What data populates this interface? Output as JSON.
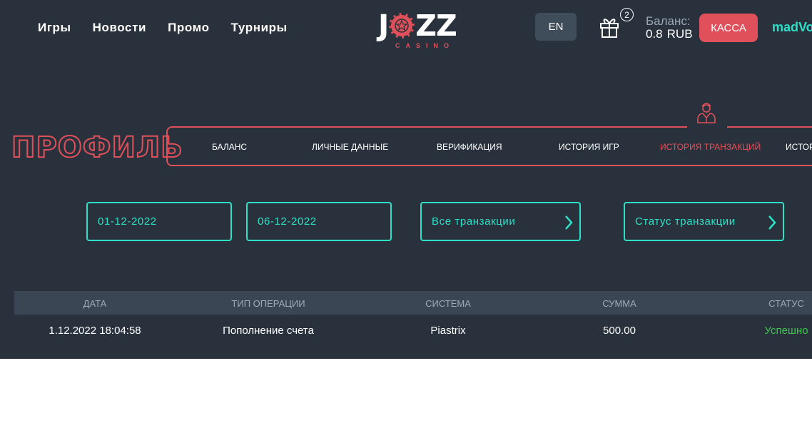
{
  "nav": {
    "games": "Игры",
    "news": "Новости",
    "promo": "Промо",
    "tournaments": "Турниры"
  },
  "logo": {
    "main_left": "J",
    "main_right": "ZZ",
    "sub": "CASINO"
  },
  "header": {
    "lang": "EN",
    "gift_count": "2",
    "balance_label": "Баланс:",
    "balance_amount": "0.8",
    "balance_currency": "RUB",
    "cash_button": "КАССА",
    "username": "madVo"
  },
  "profile": {
    "title": "ПРОФИЛЬ",
    "tabs": [
      {
        "label": "БАЛАНС"
      },
      {
        "label": "ЛИЧНЫЕ ДАННЫЕ"
      },
      {
        "label": "ВЕРИФИКАЦИЯ"
      },
      {
        "label": "ИСТОРИЯ ИГР"
      },
      {
        "label": "ИСТОРИЯ ТРАНЗАКЦИЙ"
      },
      {
        "label": "ИСТОР"
      }
    ]
  },
  "filters": {
    "date_from": "01-12-2022",
    "date_to": "06-12-2022",
    "type": "Все транзакции",
    "status": "Статус транзакции"
  },
  "table": {
    "columns": [
      "ДАТА",
      "ТИП ОПЕРАЦИИ",
      "СИСТЕМА",
      "СУММА",
      "СТАТУС"
    ],
    "rows": [
      {
        "date": "1.12.2022 18:04:58",
        "type": "Пополнение счета",
        "system": "Piastrix",
        "amount": "500.00",
        "status": "Успешно"
      }
    ]
  },
  "colors": {
    "background": "#29323c",
    "accent_red": "#e0505a",
    "accent_teal": "#2de0c8",
    "success": "#3ec34f"
  }
}
